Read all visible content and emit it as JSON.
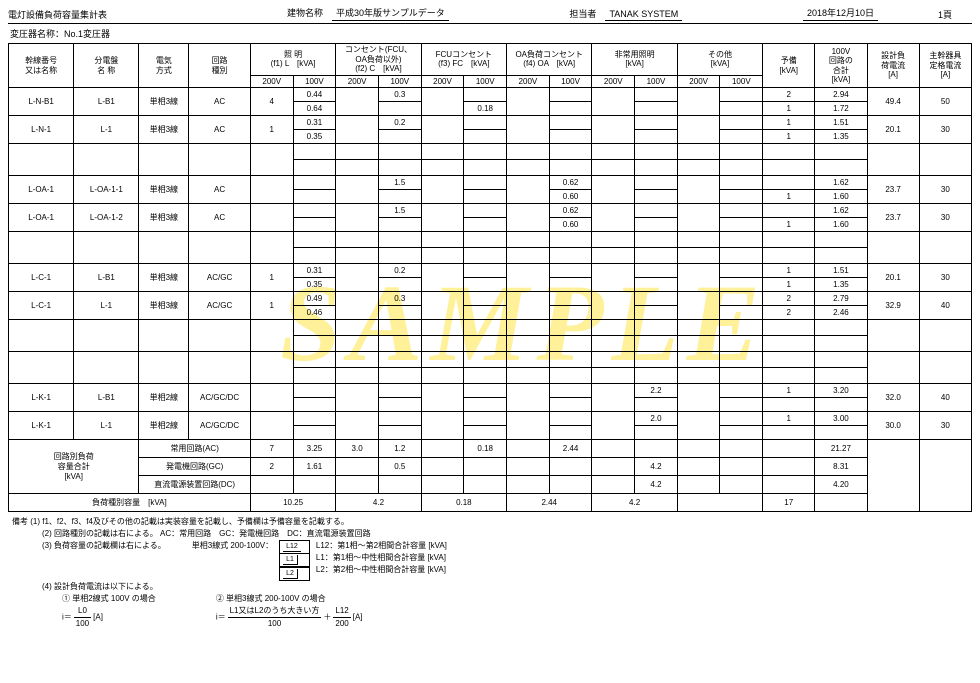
{
  "header": {
    "title": "電灯設備負荷容量集計表",
    "building_label": "建物名称",
    "building": "平成30年版サンプルデータ",
    "person_label": "担当者",
    "person": "TANAK SYSTEM",
    "date": "2018年12月10日",
    "page": "1頁"
  },
  "subheader": "変圧器名称：No.1変圧器",
  "cols": {
    "c1": "幹線番号\n又は名称",
    "c2": "分電盤\n名 称",
    "c3": "電気\n方式",
    "c4": "回路\n種別",
    "c5a": "照 明",
    "c5b": "(f1) L　[kVA]",
    "c6a": "コンセント(FCU、\nOA負荷以外)",
    "c6b": "(f2) C　[kVA]",
    "c7a": "FCUコンセント",
    "c7b": "(f3) FC　[kVA]",
    "c8a": "OA負荷コンセント",
    "c8b": "(f4) OA　[kVA]",
    "c9a": "非常用照明",
    "c9b": "[kVA]",
    "c10a": "その他",
    "c10b": "[kVA]",
    "c11a": "予備",
    "c11b": "[kVA]",
    "c12a": "100V\n回路の\n合計",
    "c12b": "[kVA]",
    "c13a": "設計負\n荷電流",
    "c13b": "[A]",
    "c14a": "主幹器具\n定格電流",
    "c14b": "[A]",
    "v200": "200V",
    "v100": "100V"
  },
  "rows": [
    {
      "r1": "L-N-B1",
      "r2": "L-B1",
      "r3": "単相3線",
      "r4": "AC",
      "l200": "4",
      "l100a": "0.44",
      "l100b": "0.64",
      "c100a": "0.3",
      "c100b": "",
      "fc100a": "",
      "fc100b": "0.18",
      "oa100a": "",
      "oa100b": "",
      "e100a": "",
      "e100b": "",
      "o200": "",
      "o100": "",
      "res_a": "2",
      "res_b": "1",
      "sum_a": "2.94",
      "sum_b": "1.72",
      "amp": "49.4",
      "rated": "50"
    },
    {
      "r1": "L-N-1",
      "r2": "L-1",
      "r3": "単相3線",
      "r4": "AC",
      "l200": "1",
      "l100a": "0.31",
      "l100b": "0.35",
      "c100a": "0.2",
      "c100b": "",
      "fc100a": "",
      "fc100b": "",
      "oa100a": "",
      "oa100b": "",
      "e100a": "",
      "e100b": "",
      "o200": "",
      "o100": "",
      "res_a": "1",
      "res_b": "1",
      "sum_a": "1.51",
      "sum_b": "1.35",
      "amp": "20.1",
      "rated": "30"
    },
    {
      "blank": true
    },
    {
      "r1": "L-OA-1",
      "r2": "L-OA-1-1",
      "r3": "単相3線",
      "r4": "AC",
      "l200": "",
      "l100a": "",
      "l100b": "",
      "c100a": "1.5",
      "c100b": "",
      "fc100a": "",
      "fc100b": "",
      "oa100a": "0.62",
      "oa100b": "0.60",
      "e100a": "",
      "e100b": "",
      "o200": "",
      "o100": "",
      "res_a": "",
      "res_b": "1",
      "sum_a": "1.62",
      "sum_b": "1.60",
      "amp": "23.7",
      "rated": "30"
    },
    {
      "r1": "L-OA-1",
      "r2": "L-OA-1-2",
      "r3": "単相3線",
      "r4": "AC",
      "l200": "",
      "l100a": "",
      "l100b": "",
      "c100a": "1.5",
      "c100b": "",
      "fc100a": "",
      "fc100b": "",
      "oa100a": "0.62",
      "oa100b": "0.60",
      "e100a": "",
      "e100b": "",
      "o200": "",
      "o100": "",
      "res_a": "",
      "res_b": "1",
      "sum_a": "1.62",
      "sum_b": "1.60",
      "amp": "23.7",
      "rated": "30"
    },
    {
      "blank": true
    },
    {
      "r1": "L-C-1",
      "r2": "L-B1",
      "r3": "単相3線",
      "r4": "AC/GC",
      "l200": "1",
      "l100a": "0.31",
      "l100b": "0.35",
      "c100a": "0.2",
      "c100b": "",
      "fc100a": "",
      "fc100b": "",
      "oa100a": "",
      "oa100b": "",
      "e100a": "",
      "e100b": "",
      "o200": "",
      "o100": "",
      "res_a": "1",
      "res_b": "1",
      "sum_a": "1.51",
      "sum_b": "1.35",
      "amp": "20.1",
      "rated": "30"
    },
    {
      "r1": "L-C-1",
      "r2": "L-1",
      "r3": "単相3線",
      "r4": "AC/GC",
      "l200": "1",
      "l100a": "0.49",
      "l100b": "0.46",
      "c100a": "0.3",
      "c100b": "",
      "fc100a": "",
      "fc100b": "",
      "oa100a": "",
      "oa100b": "",
      "e100a": "",
      "e100b": "",
      "o200": "",
      "o100": "",
      "res_a": "2",
      "res_b": "2",
      "sum_a": "2.79",
      "sum_b": "2.46",
      "amp": "32.9",
      "rated": "40"
    },
    {
      "blank": true
    },
    {
      "blank": true
    },
    {
      "r1": "L-K-1",
      "r2": "L-B1",
      "r3": "単相2線",
      "r4": "AC/GC/DC",
      "l200": "",
      "l100a": "",
      "l100b": "",
      "c100a": "",
      "c100b": "",
      "fc100a": "",
      "fc100b": "",
      "oa100a": "",
      "oa100b": "",
      "e100a": "2.2",
      "e100b": "",
      "o200": "",
      "o100": "",
      "res_a": "1",
      "res_b": "",
      "sum_a": "3.20",
      "sum_b": "",
      "amp": "32.0",
      "rated": "40"
    },
    {
      "r1": "L-K-1",
      "r2": "L-1",
      "r3": "単相2線",
      "r4": "AC/GC/DC",
      "l200": "",
      "l100a": "",
      "l100b": "",
      "c100a": "",
      "c100b": "",
      "fc100a": "",
      "fc100b": "",
      "oa100a": "",
      "oa100b": "",
      "e100a": "2.0",
      "e100b": "",
      "o200": "",
      "o100": "",
      "res_a": "1",
      "res_b": "",
      "sum_a": "3.00",
      "sum_b": "",
      "amp": "30.0",
      "rated": "30"
    }
  ],
  "totals": {
    "label": "回路別負荷\n容量合計\n[kVA]",
    "t1": {
      "name": "常用回路(AC)",
      "l200": "7",
      "l100": "3.25",
      "c200": "3.0",
      "c100": "1.2",
      "fc": "0.18",
      "oa": "2.44",
      "sum": "21.27"
    },
    "t2": {
      "name": "発電機回路(GC)",
      "l200": "2",
      "l100": "1.61",
      "c100": "0.5",
      "e": "4.2",
      "sum": "8.31"
    },
    "t3": {
      "name": "直流電源装置回路(DC)",
      "e": "4.2",
      "sum": "4.20"
    },
    "t4": {
      "name": "負荷種別容量　[kVA]",
      "l": "10.25",
      "c": "4.2",
      "fc": "0.18",
      "oa": "2.44",
      "e": "4.2",
      "res": "17"
    }
  },
  "notes": {
    "n1": "備考 (1) f1、f2、f3、f4及びその他の記載は実装容量を記載し、予備欄は予備容量を記載する。",
    "n2": "(2) 回路種別の記載は右による。 AC：常用回路　GC：発電機回路　DC：直流電源装置回路",
    "n3": "(3) 負荷容量の記載欄は右による。",
    "n3b": "単相3線式 200-100V：",
    "n3c1": "L12：第1相～第2相間合計容量 [kVA]",
    "n3c2": "L1：第1相～中性相間合計容量 [kVA]",
    "n3c3": "L2：第2相～中性相間合計容量 [kVA]",
    "n4": "(4) 設計負荷電流は以下による。",
    "n4a": "① 単相2線式 100V の場合",
    "n4b": "② 単相3線式 200-100V の場合",
    "fa": "L0",
    "fb": "100",
    "fc": "[A]",
    "fd": "L1又はL2のうち大きい方",
    "fe": "100",
    "ff": "L12",
    "fg": "200",
    "fh": "[A]"
  }
}
